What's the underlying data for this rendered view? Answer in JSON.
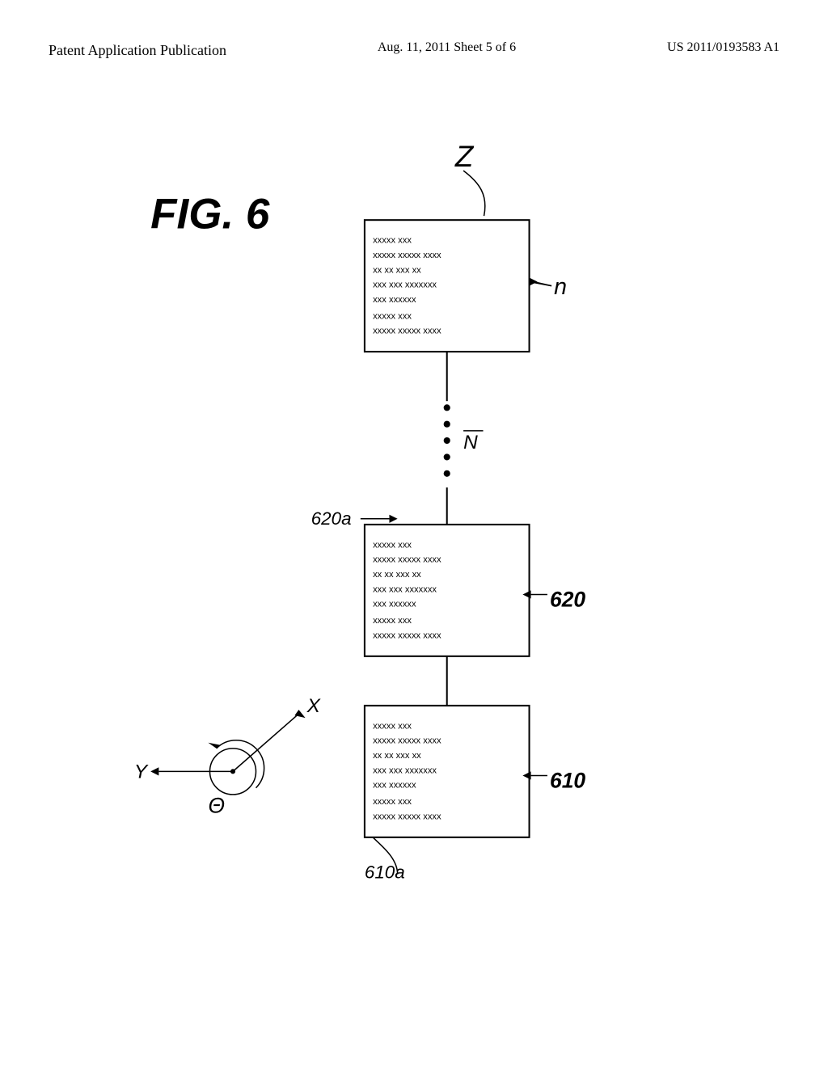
{
  "header": {
    "left_text": "Patent Application Publication",
    "center_text": "Aug. 11, 2011  Sheet 5 of 6",
    "right_text": "US 2011/0193583 A1"
  },
  "figure": {
    "label": "FIG. 6",
    "label_z": "Z",
    "label_n": "n",
    "label_N": "N",
    "label_620": "620",
    "label_620a": "620a",
    "label_610": "610",
    "label_610a": "610a",
    "label_x": "X",
    "label_y": "Y",
    "label_theta": "Θ",
    "box_content_lines": [
      "xxxxx  xxx",
      "xxxxx xxxxx  xxxx",
      "xx  xx  xxx  xx",
      "xxx  xxx  xxxxxxx",
      "xxx  xxxxxx"
    ]
  }
}
